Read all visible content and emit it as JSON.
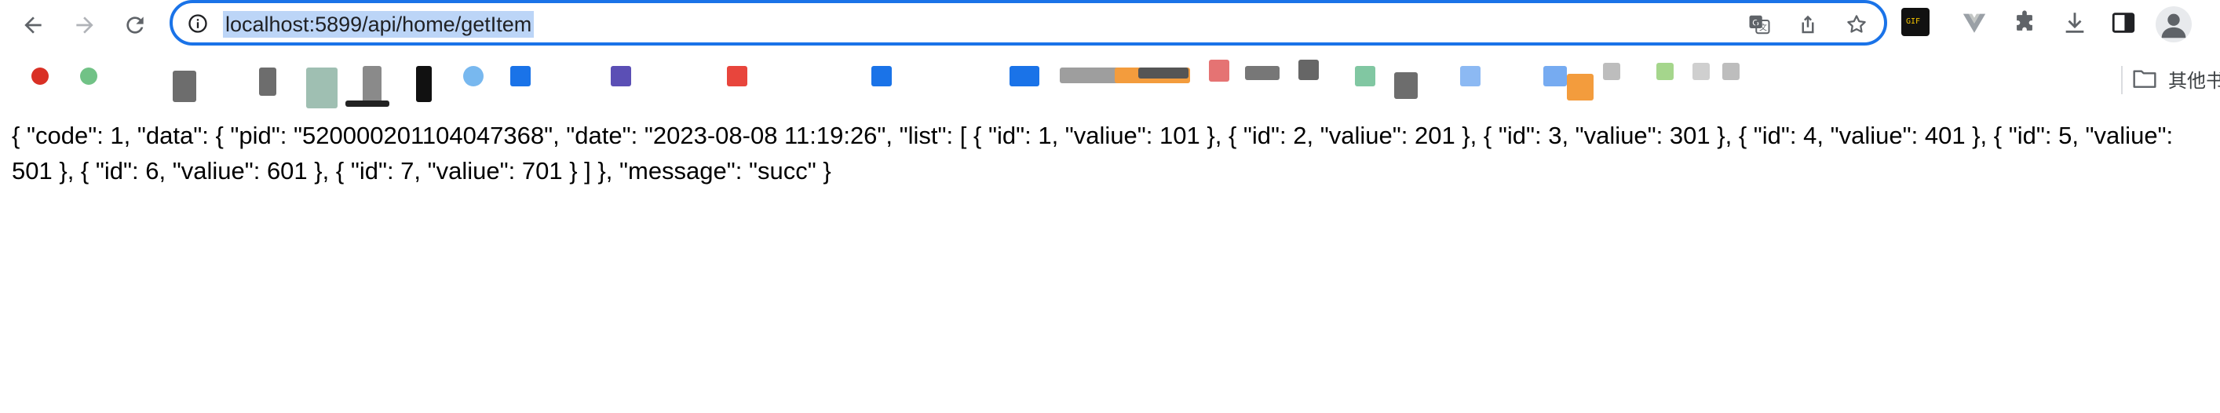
{
  "browser": {
    "address_bar": {
      "url": "localhost:5899/api/home/getItem"
    },
    "icons": {
      "back": "arrow-left-icon",
      "forward": "arrow-right-icon",
      "reload": "reload-icon",
      "site_info": "info-icon",
      "translate": "translate-icon",
      "share": "share-icon",
      "bookmark": "star-icon",
      "extensions": "puzzle-icon",
      "downloads": "download-icon",
      "side_panel": "side-panel-icon",
      "profile": "avatar-icon"
    },
    "extension_badge": "GIF"
  },
  "bookmarks_bar": {
    "other_bookmarks_label": "其他书签"
  },
  "page": {
    "json_text": "{ \"code\": 1, \"data\": { \"pid\": \"520000201104047368\", \"date\": \"2023-08-08 11:19:26\", \"list\": [ { \"id\": 1, \"valiue\": 101 }, { \"id\": 2, \"valiue\": 201 }, { \"id\": 3, \"valiue\": 301 }, { \"id\": 4, \"valiue\": 401 }, { \"id\": 5, \"valiue\": 501 }, { \"id\": 6, \"valiue\": 601 }, { \"id\": 7, \"valiue\": 701 } ] }, \"message\": \"succ\" }"
  },
  "colors": {
    "focus_ring": "#1a73e8",
    "url_selection": "#bcd5f7",
    "icon": "#5f6368"
  }
}
